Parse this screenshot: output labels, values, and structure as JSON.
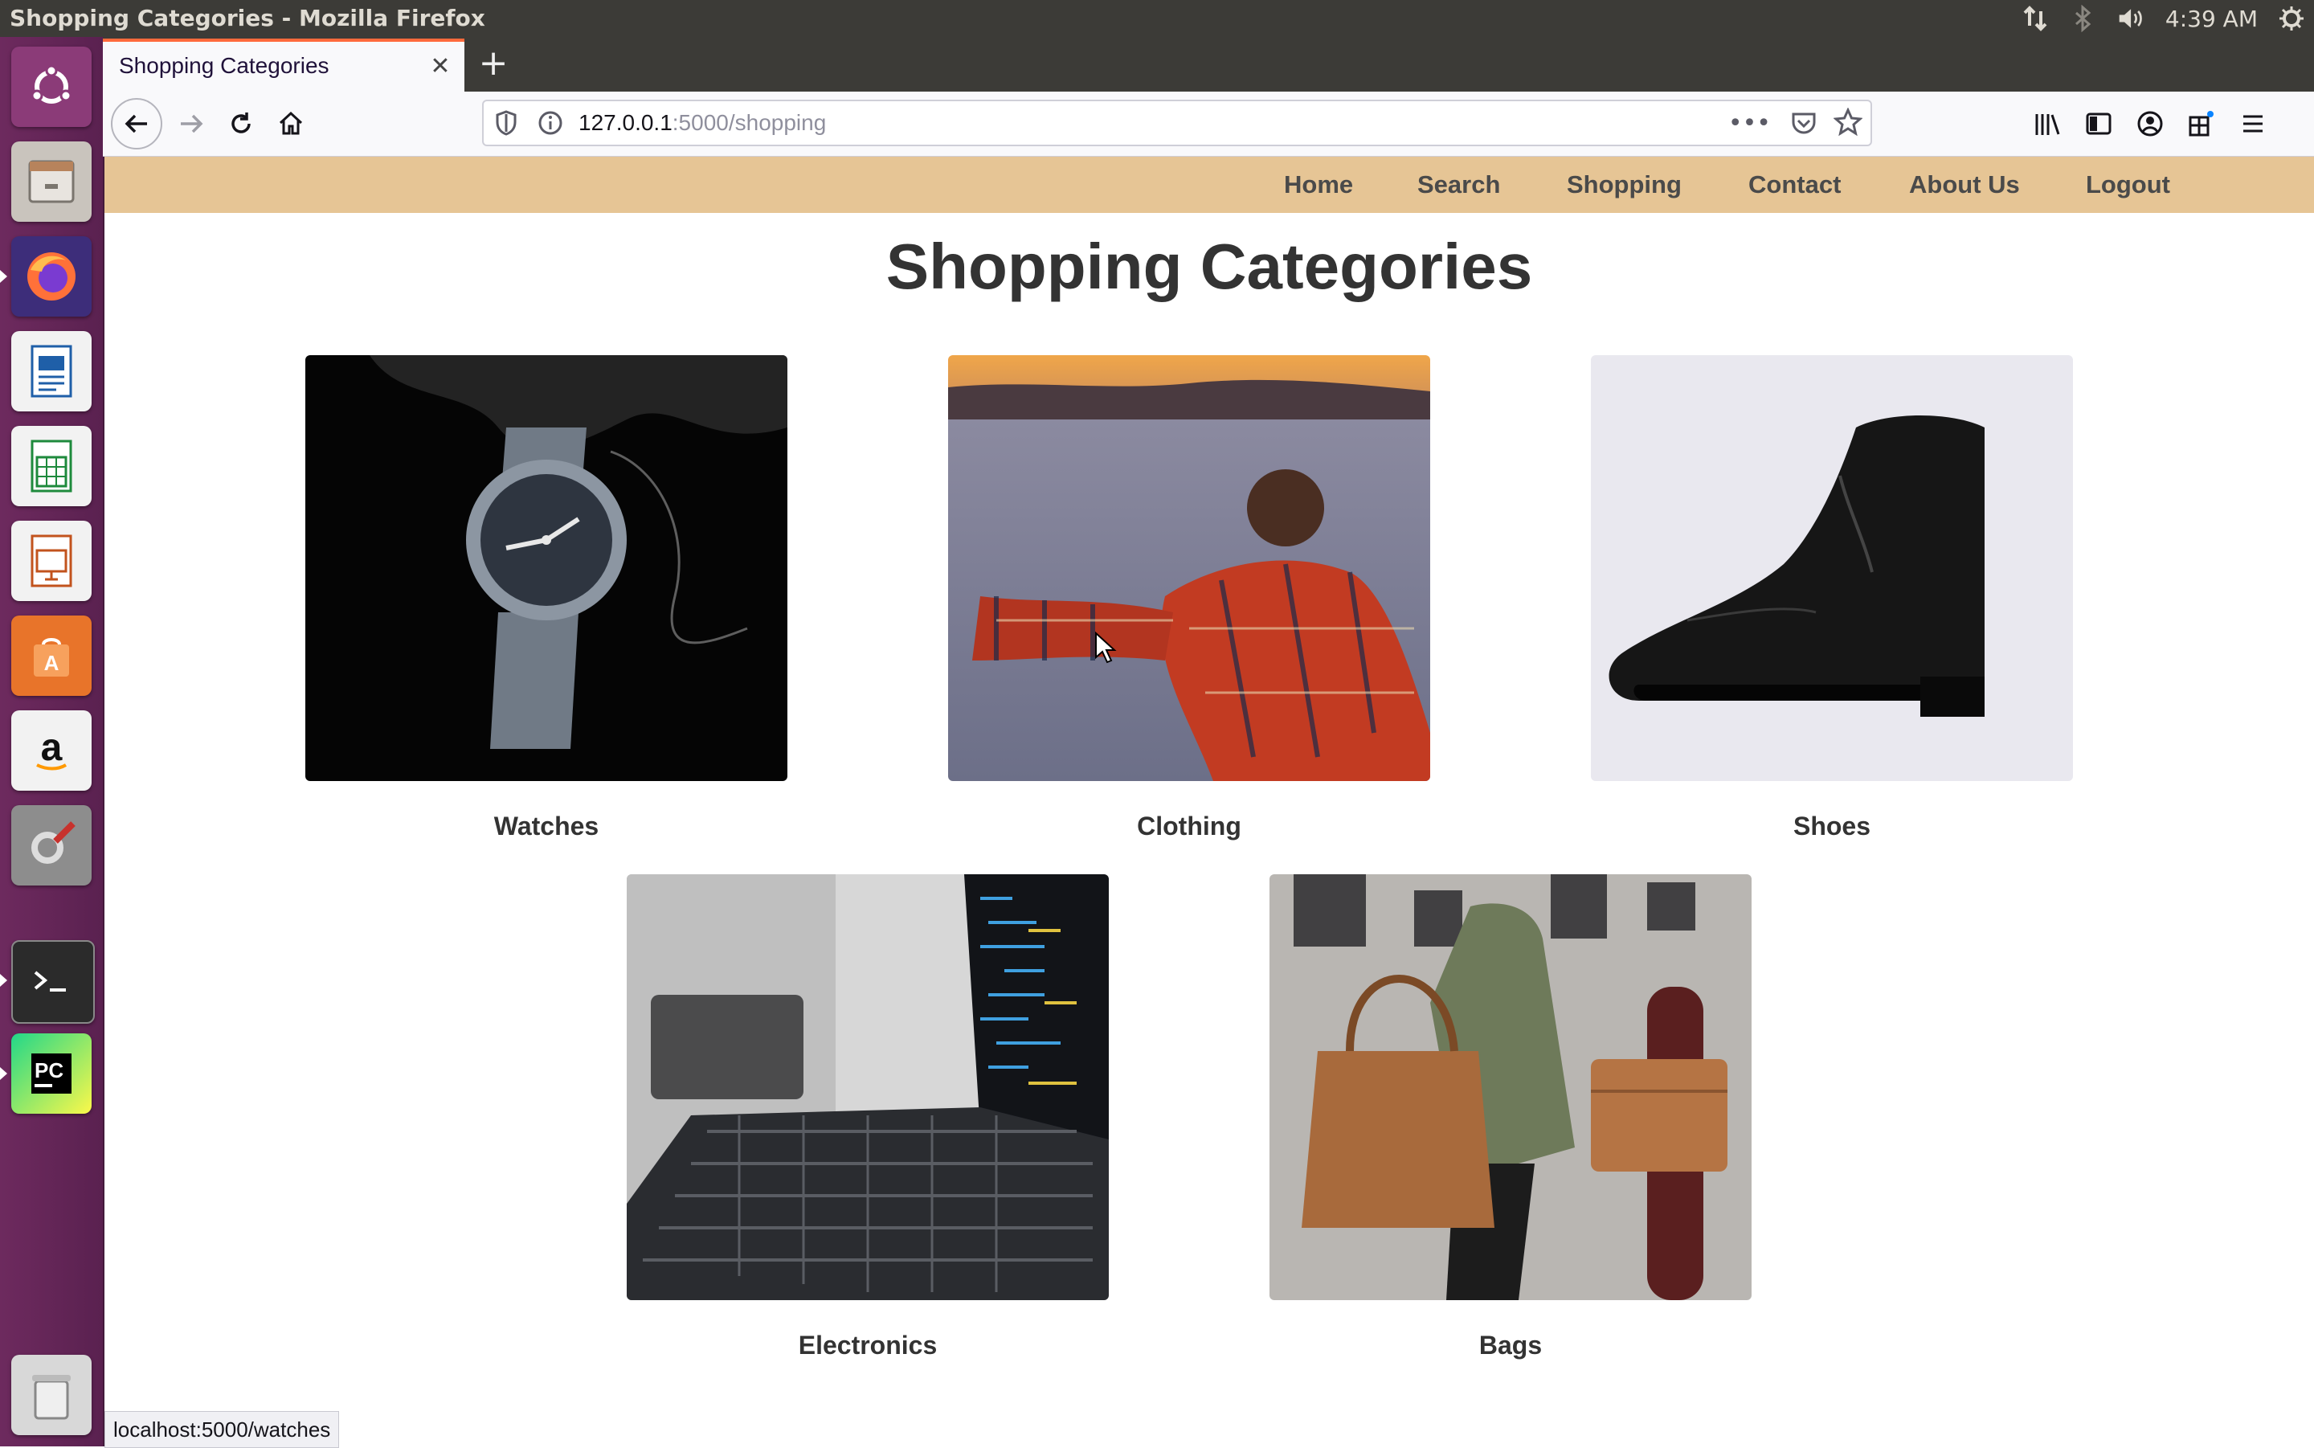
{
  "window_title": "Shopping Categories - Mozilla Firefox",
  "panel": {
    "clock": "4:39 AM"
  },
  "browser": {
    "tab_title": "Shopping Categories",
    "url_host": "127.0.0.1",
    "url_path": ":5000/shopping",
    "status_url": "localhost:5000/watches"
  },
  "site": {
    "nav": [
      "Home",
      "Search",
      "Shopping",
      "Contact",
      "About Us",
      "Logout"
    ],
    "title": "Shopping Categories",
    "categories": [
      {
        "label": "Watches"
      },
      {
        "label": "Clothing"
      },
      {
        "label": "Shoes"
      },
      {
        "label": "Electronics"
      },
      {
        "label": "Bags"
      }
    ]
  },
  "launcher": [
    "ubuntu-dash-icon",
    "files-icon",
    "firefox-icon",
    "writer-icon",
    "calc-icon",
    "impress-icon",
    "software-center-icon",
    "amazon-icon",
    "settings-icon",
    "terminal-icon",
    "pycharm-icon",
    "trash-icon"
  ],
  "colors": {
    "site_nav_bg": "#e6c595",
    "launcher_bg": "#5e2750",
    "tab_accent": "#ff6a3c"
  }
}
